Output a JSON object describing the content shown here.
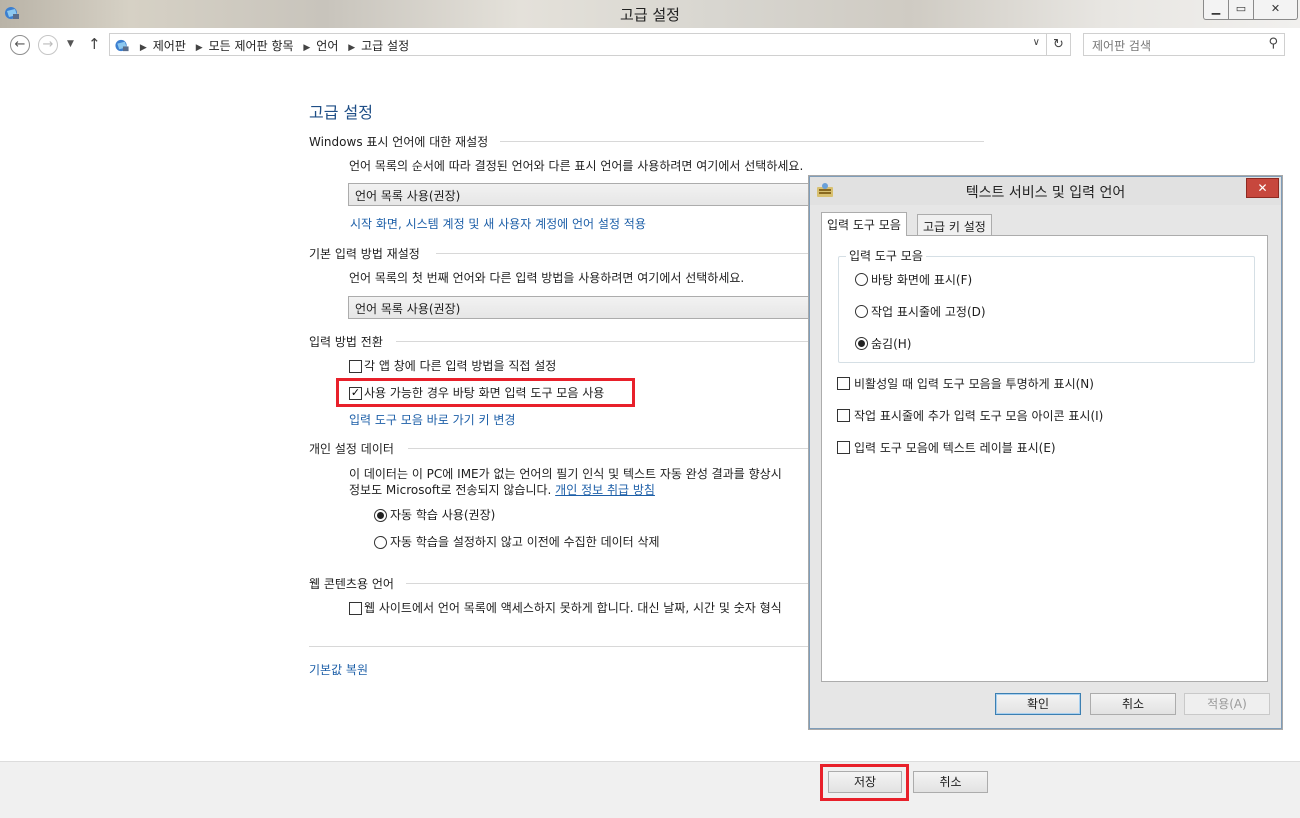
{
  "window": {
    "title": "고급 설정"
  },
  "address": {
    "crumbs": [
      "제어판",
      "모든 제어판 항목",
      "언어",
      "고급 설정"
    ],
    "search_placeholder": "제어판 검색"
  },
  "main": {
    "heading": "고급 설정",
    "display_language": {
      "title": "Windows 표시 언어에 대한 재설정",
      "desc": "언어 목록의 순서에 따라 결정된 언어와 다른 표시 언어를 사용하려면 여기에서 선택하세요.",
      "combo_value": "언어 목록 사용(권장)",
      "apply_link": "시작 화면, 시스템 계정 및 새 사용자 계정에 언어 설정 적용"
    },
    "input_method": {
      "title": "기본 입력 방법 재설정",
      "desc": "언어 목록의 첫 번째 언어와 다른 입력 방법을 사용하려면 여기에서 선택하세요.",
      "combo_value": "언어 목록 사용(권장)"
    },
    "switching": {
      "title": "입력 방법 전환",
      "per_app_label": "각 앱 창에 다른 입력 방법을 직접 설정",
      "per_app_checked": false,
      "desktop_bar_label": "사용 가능한 경우 바탕 화면 입력 도구 모음 사용",
      "desktop_bar_checked": true,
      "hotkey_link": "입력 도구 모음 바로 가기 키 변경"
    },
    "personalization": {
      "title": "개인 설정 데이터",
      "desc1": "이 데이터는 이 PC에 IME가 없는 언어의 필기 인식 및 텍스트 자동 완성 결과를 향상시",
      "desc2_prefix": "정보도 Microsoft로 전송되지 않습니다. ",
      "privacy_link": "개인 정보 취급 방침",
      "option_auto": "자동 학습 사용(권장)",
      "option_delete": "자동 학습을 설정하지 않고 이전에 수집한 데이터 삭제",
      "selected": "auto"
    },
    "web_content": {
      "title": "웹 콘텐츠용 언어",
      "checkbox_label": "웹 사이트에서 언어 목록에 액세스하지 못하게 합니다. 대신 날짜, 시간 및 숫자 형식",
      "checked": false
    },
    "restore_link": "기본값 복원"
  },
  "footer": {
    "save_label": "저장",
    "cancel_label": "취소"
  },
  "dialog": {
    "title": "텍스트 서비스 및 입력 언어",
    "tabs": [
      "입력 도구 모음",
      "고급 키 설정"
    ],
    "active_tab": 0,
    "group_label": "입력 도구 모음",
    "radio_options": [
      "바탕 화면에 표시(F)",
      "작업 표시줄에 고정(D)",
      "숨김(H)"
    ],
    "radio_selected": 2,
    "checkboxes": [
      {
        "label": "비활성일 때 입력 도구 모음을 투명하게 표시(N)",
        "checked": false
      },
      {
        "label": "작업 표시줄에 추가 입력 도구 모음 아이콘 표시(I)",
        "checked": false
      },
      {
        "label": "입력 도구 모음에 텍스트 레이블 표시(E)",
        "checked": false
      }
    ],
    "buttons": {
      "ok": "확인",
      "cancel": "취소",
      "apply": "적용(A)"
    }
  },
  "highlight_color": "#e8202a",
  "link_color": "#1d5fa8"
}
